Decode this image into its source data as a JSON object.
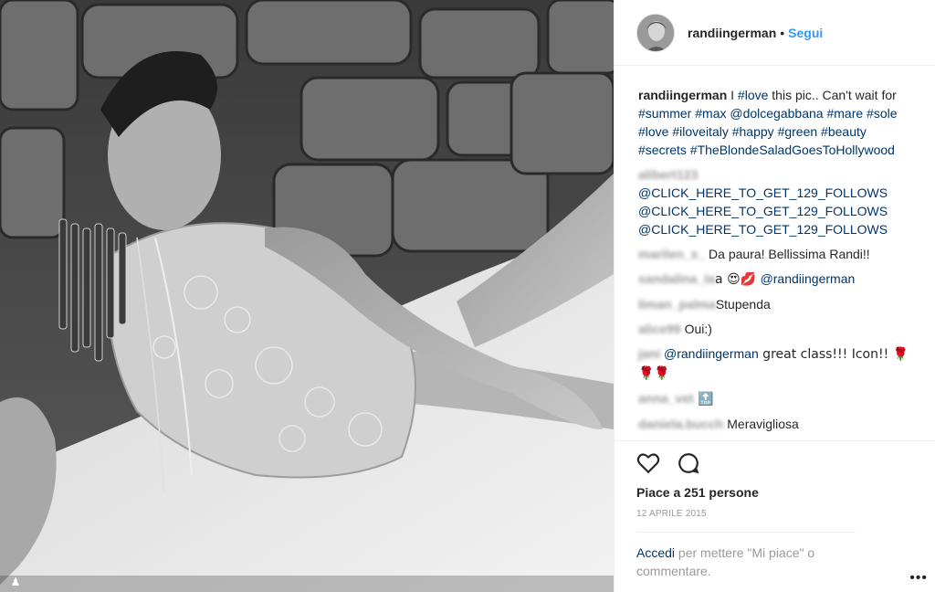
{
  "post": {
    "username": "randiingerman",
    "separator": "•",
    "follow_label": "Segui"
  },
  "caption": {
    "username": "randiingerman",
    "parts": [
      " I ",
      "#love",
      " this pic.. Can't wait for ",
      "#summer",
      " ",
      "#max",
      " ",
      "@dolcegabbana",
      " ",
      "#mare",
      " ",
      "#sole",
      " ",
      "#love",
      " ",
      "#iloveitaly",
      " ",
      "#happy",
      " ",
      "#green",
      " ",
      "#beauty",
      " ",
      "#secrets",
      " ",
      "#TheBlondeSaladGoesToHollywood"
    ]
  },
  "comments": [
    {
      "user": "alibert123",
      "mention": "@CLICK_HERE_TO_GET_129_FOLLOWS @CLICK_HERE_TO_GET_129_FOLLOWS @CLICK_HERE_TO_GET_129_FOLLOWS",
      "text": ""
    },
    {
      "user": "marilen_s_",
      "text": " Da paura! Bellissima Randi!!",
      "mention": ""
    },
    {
      "user": "sandalina_la",
      "text": "a 😍💋 ",
      "mention": "@randiingerman"
    },
    {
      "user": "liman_palma",
      "text": "Stupenda",
      "mention": ""
    },
    {
      "user": "alice99",
      "text": " Oui:)",
      "mention": ""
    },
    {
      "user": "jani",
      "mention": "@randiingerman",
      "text": " great class!!! Icon!! 🌹🌹🌹"
    },
    {
      "user": "anna_vet",
      "text": " 🔝",
      "mention": ""
    },
    {
      "user": "daniela.bucch",
      "text": " Meravigliosa",
      "mention": ""
    }
  ],
  "likes_text": "Piace a 251 persone",
  "date_text": "12 APRILE 2015",
  "login": {
    "link": "Accedi",
    "rest": " per mettere \"Mi piace\" o commentare."
  },
  "more_label": "•••",
  "icons": {
    "heart": "heart-icon",
    "comment": "comment-icon",
    "corner": "user-tag-icon"
  }
}
